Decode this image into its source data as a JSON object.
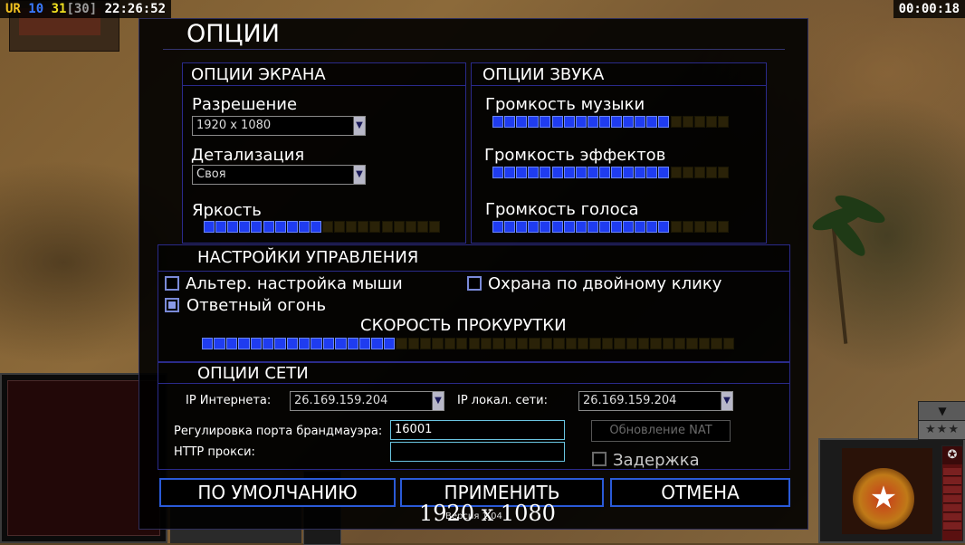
{
  "hud": {
    "tag": "UR",
    "a": "10",
    "b": "31",
    "c": "[30]",
    "clock": "22:26:52",
    "timer": "00:00:18",
    "scroll_down": "▼",
    "rank": "★★★",
    "colors": {
      "tag": "#f0c020",
      "a": "#3a7aff",
      "b": "#f0e020",
      "c": "#9a9a9a"
    }
  },
  "dialog": {
    "title": "ОПЦИИ",
    "screen": {
      "title": "ОПЦИИ ЭКРАНА",
      "resolution_label": "Разрешение",
      "resolution_value": "1920 x 1080",
      "detail_label": "Детализация",
      "detail_value": "Своя",
      "brightness_label": "Яркость",
      "brightness": {
        "filled": 10,
        "total": 20
      }
    },
    "sound": {
      "title": "ОПЦИИ ЗВУКА",
      "music_label": "Громкость музыки",
      "music": {
        "filled": 15,
        "total": 20
      },
      "effects_label": "Громкость эффектов",
      "effects": {
        "filled": 15,
        "total": 20
      },
      "voice_label": "Громкость голоса",
      "voice": {
        "filled": 15,
        "total": 20
      }
    },
    "controls": {
      "title": "НАСТРОЙКИ УПРАВЛЕНИЯ",
      "alt_mouse_label": "Альтер. настройка мыши",
      "alt_mouse_checked": false,
      "double_click_label": "Охрана по двойному клику",
      "double_click_checked": false,
      "retaliation_label": "Ответный огонь",
      "retaliation_checked": true,
      "scroll_speed_label": "СКОРОСТЬ ПРОКУРУТКИ",
      "scroll_speed": {
        "filled": 16,
        "total": 44
      }
    },
    "network": {
      "title": "ОПЦИИ СЕТИ",
      "internet_ip_label": "IP Интернета:",
      "internet_ip_value": "26.169.159.204",
      "lan_ip_label": "IP локал. сети:",
      "lan_ip_value": "26.169.159.204",
      "firewall_label": "Регулировка порта брандмауэра:",
      "firewall_value": "16001",
      "proxy_label": "HTTP прокси:",
      "proxy_value": "",
      "nat_button": "Обновление NAT",
      "delay_label": "Задержка",
      "delay_checked": false
    },
    "buttons": {
      "defaults": "ПО УМОЛЧАНИЮ",
      "apply": "ПРИМЕНИТЬ",
      "cancel": "ОТМЕНА"
    },
    "overlay_resolution": "1920 x 1080",
    "version": "Версия 1.04"
  }
}
